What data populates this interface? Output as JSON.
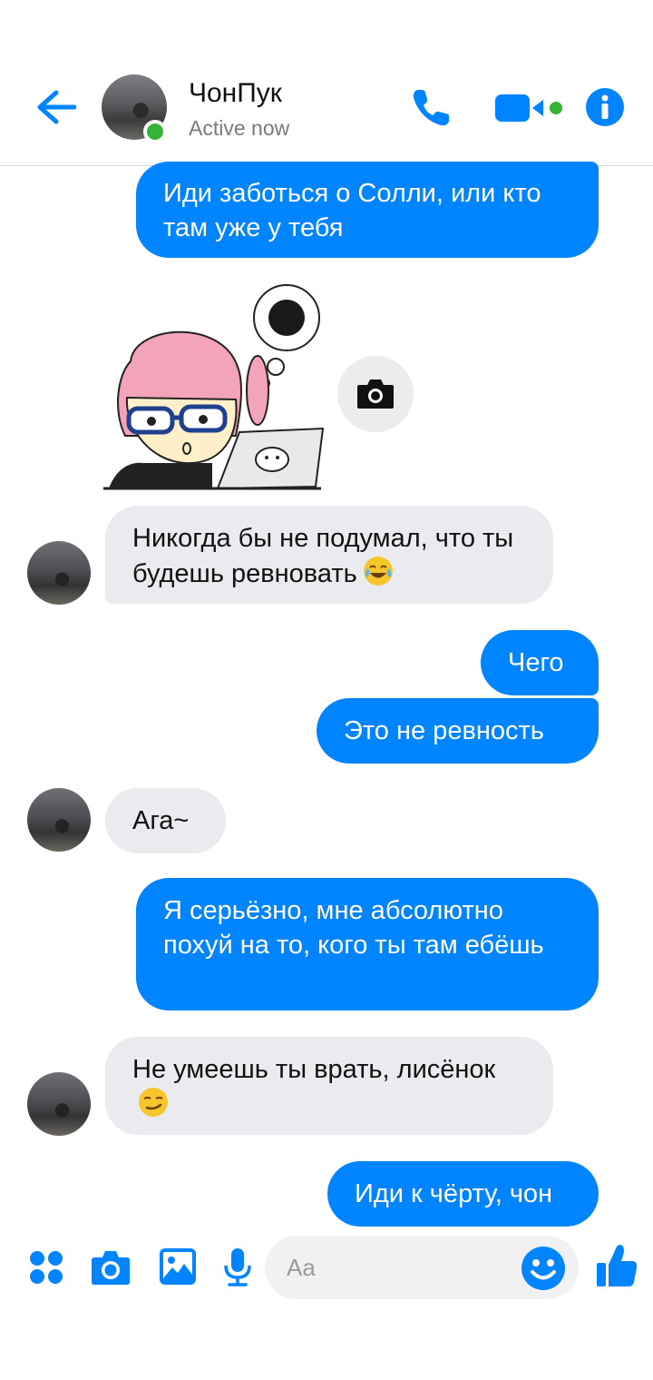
{
  "header": {
    "contact_name": "ЧонПук",
    "status": "Active now"
  },
  "messages": [
    {
      "side": "out",
      "text": "Иди заботься о Солли, или кто там уже у тебя"
    },
    {
      "side": "in",
      "text": "Никогда бы не подумал, что ты будешь ревновать",
      "emoji": "tears-of-joy"
    },
    {
      "side": "out",
      "text": "Чего"
    },
    {
      "side": "out",
      "text": "Это не ревность"
    },
    {
      "side": "in",
      "text": "Ага~"
    },
    {
      "side": "out",
      "text": "Я серьёзно, мне абсолютно похуй на то, кого ты там ебёшь"
    },
    {
      "side": "in",
      "text": "Не умеешь ты врать, лисёнок",
      "emoji": "smirk"
    },
    {
      "side": "out",
      "text": "Иди к чёрту, чон"
    }
  ],
  "composer": {
    "placeholder": "Aa"
  },
  "colors": {
    "accent": "#0084ff",
    "incoming_bubble": "#ebebef",
    "online": "#36b336"
  }
}
